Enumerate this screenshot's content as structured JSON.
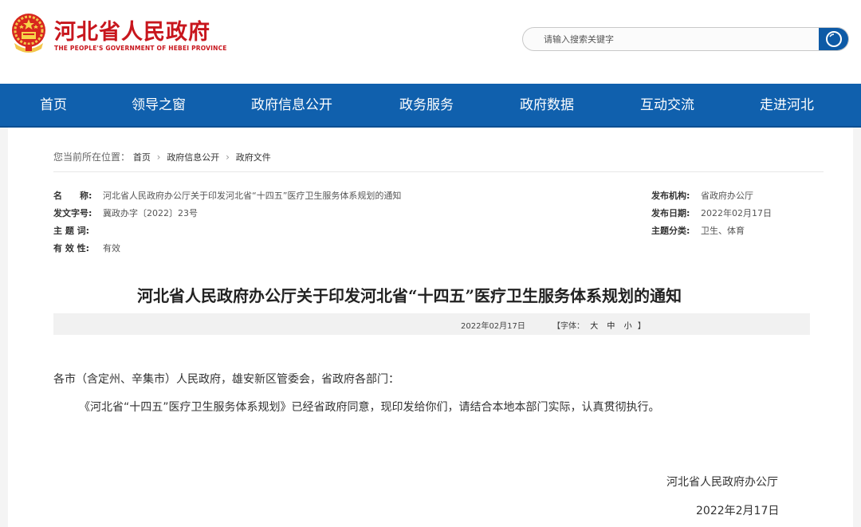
{
  "header": {
    "site_title": "河北省人民政府",
    "site_subtitle": "THE PEOPLE'S GOVERNMENT OF HEBEI PROVINCE",
    "search_placeholder": "请输入搜索关键字"
  },
  "nav": [
    "首页",
    "领导之窗",
    "政府信息公开",
    "政务服务",
    "政府数据",
    "互动交流",
    "走进河北"
  ],
  "breadcrumb": {
    "label": "您当前所在位置：",
    "items": [
      "首页",
      "政府信息公开",
      "政府文件"
    ]
  },
  "meta": {
    "name_key": "名　　称:",
    "name_value": "河北省人民政府办公厅关于印发河北省“十四五”医疗卫生服务体系规划的通知",
    "doc_no_key": "发文字号:",
    "doc_no_value": "冀政办字〔2022〕23号",
    "subject_key": "主 题 词:",
    "subject_value": "",
    "validity_key": "有 效 性:",
    "validity_value": "有效",
    "issuer_key": "发布机构:",
    "issuer_value": "省政府办公厅",
    "date_key": "发布日期:",
    "date_value": "2022年02月17日",
    "category_key": "主题分类:",
    "category_value": "卫生、体育"
  },
  "document": {
    "title": "河北省人民政府办公厅关于印发河北省“十四五”医疗卫生服务体系规划的通知",
    "info_date": "2022年02月17日",
    "font_label": "【字体：",
    "font_large": "大",
    "font_medium": "中",
    "font_small": "小",
    "font_close": "】",
    "salutation": "各市（含定州、辛集市）人民政府，雄安新区管委会，省政府各部门：",
    "paragraph": "《河北省“十四五”医疗卫生服务体系规划》已经省政府同意，现印发给你们，请结合本地本部门实际，认真贯彻执行。",
    "signature": "河北省人民政府办公厅",
    "sign_date": "2022年2月17日"
  },
  "colors": {
    "brand_red": "#c8161d",
    "nav_blue": "#1060ad",
    "search_blue": "#0d5aa6"
  }
}
